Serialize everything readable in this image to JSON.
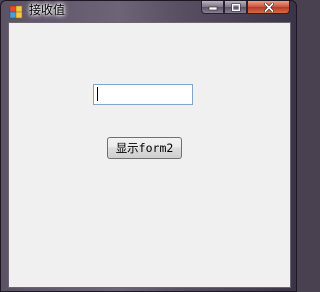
{
  "window": {
    "title": "接收值"
  },
  "form": {
    "input_value": "",
    "show_button_label": "显示form2"
  },
  "colors": {
    "client_background": "#f0f0f0",
    "input_border": "#7fa6c8",
    "close_button": "#c9533b"
  },
  "icons": [
    "app-icon",
    "minimize-icon",
    "maximize-icon",
    "close-icon"
  ]
}
